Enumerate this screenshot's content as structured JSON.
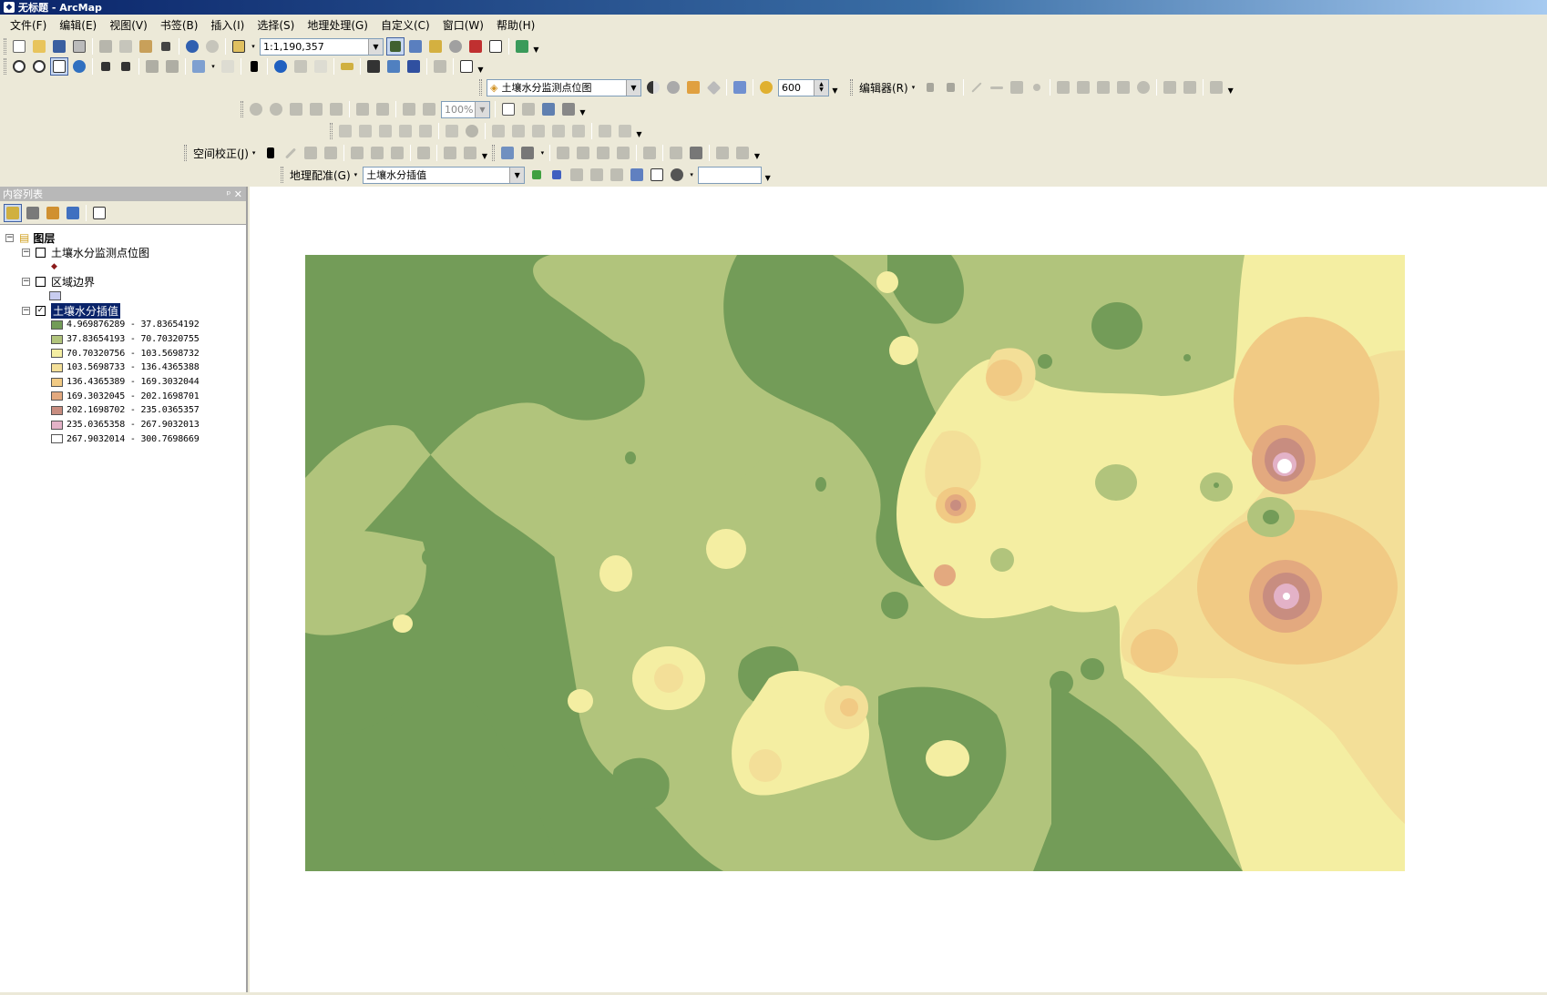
{
  "window": {
    "title": "无标题 - ArcMap"
  },
  "menu": [
    "文件(F)",
    "编辑(E)",
    "视图(V)",
    "书签(B)",
    "插入(I)",
    "选择(S)",
    "地理处理(G)",
    "自定义(C)",
    "窗口(W)",
    "帮助(H)"
  ],
  "toolbar": {
    "scale": "1:1,190,357",
    "target_layer": "土壤水分监测点位图",
    "resolution": "600",
    "zoom_percent": "100%",
    "editor_label": "编辑器(R)",
    "spatial_adjust_label": "空间校正(J)",
    "georef_label": "地理配准(G)",
    "georef_layer": "土壤水分插值",
    "georef_box": ""
  },
  "toc": {
    "title": "内容列表",
    "pin": "ᵖ ✕",
    "root": "图层",
    "layers": [
      {
        "name": "土壤水分监测点位图",
        "checked": false,
        "expander": "⊟"
      },
      {
        "name": "区域边界",
        "checked": false,
        "expander": "⊟"
      },
      {
        "name": "土壤水分插值",
        "checked": true,
        "expander": "⊟"
      }
    ],
    "classes": [
      {
        "label": "4.969876289 - 37.83654192",
        "color": "#739c58"
      },
      {
        "label": "37.83654193 - 70.70320755",
        "color": "#b1c47c"
      },
      {
        "label": "70.70320756 - 103.5698732",
        "color": "#f4eea2"
      },
      {
        "label": "103.5698733 - 136.4365388",
        "color": "#f3df98"
      },
      {
        "label": "136.4365389 - 169.3032044",
        "color": "#f1ca84"
      },
      {
        "label": "169.3032045 - 202.1698701",
        "color": "#e3a97f"
      },
      {
        "label": "202.1698702 - 235.0365357",
        "color": "#c88d80"
      },
      {
        "label": "235.0365358 - 267.9032013",
        "color": "#e3b2c7"
      },
      {
        "label": "267.9032014 - 300.7698669",
        "color": "#ffffff"
      }
    ]
  },
  "colors": {
    "c1": "#739c58",
    "c2": "#b1c47c",
    "c3": "#f4eea2",
    "c4": "#f3df98",
    "c5": "#f1ca84",
    "c6": "#e3a97f",
    "c7": "#c88d80",
    "c8": "#e3b2c7",
    "c9": "#ffffff"
  }
}
